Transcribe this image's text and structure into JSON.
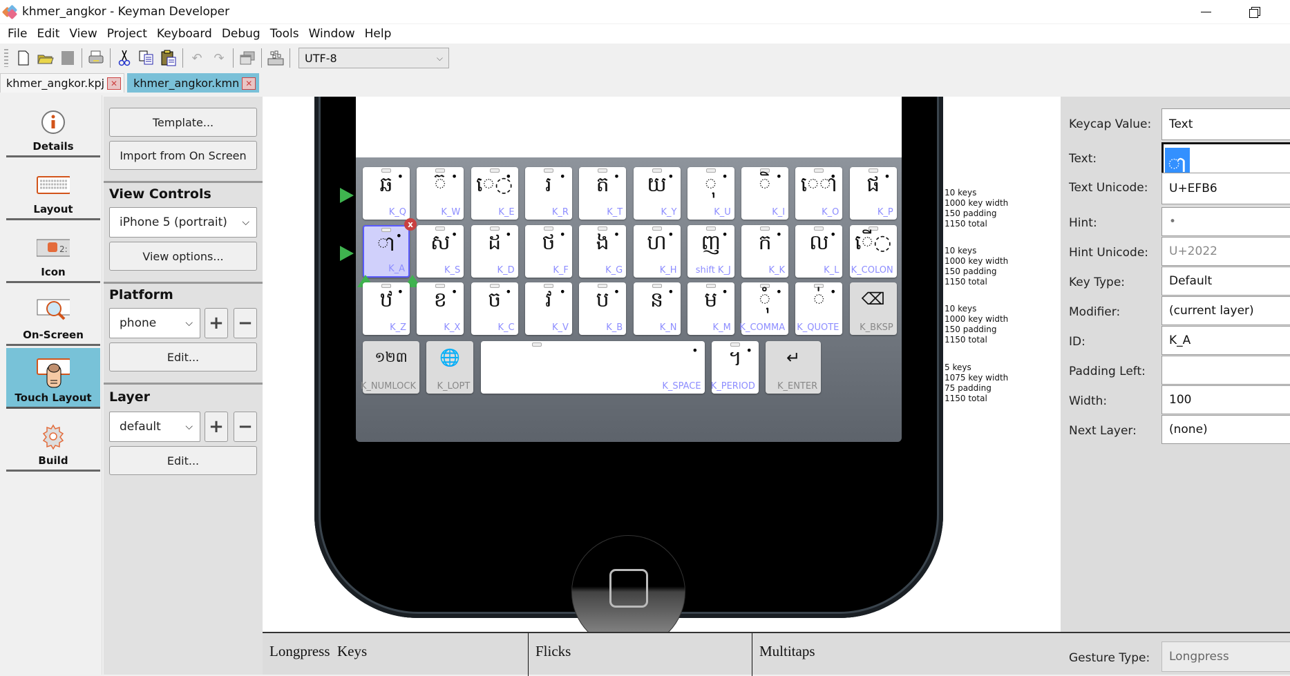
{
  "window": {
    "title": "khmer_angkor - Keyman Developer",
    "minimize_icon": "minimize-icon",
    "restore_icon": "restore-icon"
  },
  "menu": [
    "File",
    "Edit",
    "View",
    "Project",
    "Keyboard",
    "Debug",
    "Tools",
    "Window",
    "Help"
  ],
  "toolbar": {
    "icons": [
      "new-file-icon",
      "open-folder-icon",
      "save-icon",
      "print-icon",
      "cut-icon",
      "copy-icon",
      "paste-icon",
      "undo-icon",
      "redo-icon",
      "window-icon",
      "keyboard-charmap-icon"
    ],
    "encoding": "UTF-8"
  },
  "tabs": [
    {
      "label": "khmer_angkor.kpj",
      "active": false
    },
    {
      "label": "khmer_angkor.kmn",
      "active": true
    }
  ],
  "nav": [
    {
      "label": "Details",
      "icon": "info-icon",
      "active": false
    },
    {
      "label": "Layout",
      "icon": "keyboard-icon",
      "active": false
    },
    {
      "label": "Icon",
      "icon": "icon-preview-icon",
      "active": false
    },
    {
      "label": "On-Screen",
      "icon": "onscreen-keyboard-icon",
      "active": false
    },
    {
      "label": "Touch Layout",
      "icon": "touch-keyboard-icon",
      "active": true
    },
    {
      "label": "Build",
      "icon": "gear-icon",
      "active": false
    }
  ],
  "left_panel": {
    "template_btn": "Template...",
    "import_btn": "Import from On Screen",
    "view_controls_heading": "View Controls",
    "device": "iPhone 5 (portrait)",
    "view_options_btn": "View options...",
    "platform_heading": "Platform",
    "platform": "phone",
    "platform_edit_btn": "Edit...",
    "layer_heading": "Layer",
    "layer": "default",
    "layer_edit_btn": "Edit...",
    "add_symbol": "+",
    "remove_symbol": "−"
  },
  "keyboard": {
    "rows": [
      [
        {
          "cap": "ឆ",
          "id": "K_Q",
          "hint": "•"
        },
        {
          "cap": "◌៊",
          "id": "K_W",
          "hint": "•"
        },
        {
          "cap": "េ◌",
          "id": "K_E",
          "hint": "•"
        },
        {
          "cap": "រ",
          "id": "K_R",
          "hint": "•"
        },
        {
          "cap": "ត",
          "id": "K_T",
          "hint": "•"
        },
        {
          "cap": "យ",
          "id": "K_Y",
          "hint": "•"
        },
        {
          "cap": "◌ុ",
          "id": "K_U",
          "hint": "•"
        },
        {
          "cap": "◌ិ",
          "id": "K_I",
          "hint": "•"
        },
        {
          "cap": "េ◌ា",
          "id": "K_O",
          "hint": "•"
        },
        {
          "cap": "ផ",
          "id": "K_P",
          "hint": "•"
        }
      ],
      [
        {
          "cap": "◌ា",
          "id": "K_A",
          "hint": "•",
          "selected": true
        },
        {
          "cap": "ស",
          "id": "K_S",
          "hint": "•"
        },
        {
          "cap": "ដ",
          "id": "K_D",
          "hint": "•"
        },
        {
          "cap": "ថ",
          "id": "K_F",
          "hint": "•"
        },
        {
          "cap": "ង",
          "id": "K_G",
          "hint": "•"
        },
        {
          "cap": "ហ",
          "id": "K_H",
          "hint": "•"
        },
        {
          "cap": "ញ",
          "id": "shift K_J",
          "hint": "•"
        },
        {
          "cap": "ក",
          "id": "K_K",
          "hint": "•"
        },
        {
          "cap": "ល",
          "id": "K_L",
          "hint": "•"
        },
        {
          "cap": "ើ◌",
          "id": "K_COLON",
          "hint": ""
        }
      ],
      [
        {
          "cap": "ឋ",
          "id": "K_Z",
          "hint": "•"
        },
        {
          "cap": "ខ",
          "id": "K_X",
          "hint": "•"
        },
        {
          "cap": "ច",
          "id": "K_C",
          "hint": "•"
        },
        {
          "cap": "វ",
          "id": "K_V",
          "hint": "•"
        },
        {
          "cap": "ប",
          "id": "K_B",
          "hint": "•"
        },
        {
          "cap": "ន",
          "id": "K_N",
          "hint": "•"
        },
        {
          "cap": "ម",
          "id": "K_M",
          "hint": "•"
        },
        {
          "cap": "◌ុំ",
          "id": "K_COMMA",
          "hint": "•"
        },
        {
          "cap": "◌់",
          "id": "K_QUOTE",
          "hint": "•"
        },
        {
          "cap": "⌫",
          "id": "K_BKSP",
          "hint": "",
          "special": true
        }
      ],
      [
        {
          "cap": "១២៣",
          "id": "K_NUMLOCK",
          "hint": "",
          "special": true
        },
        {
          "cap": "🌐",
          "id": "K_LOPT",
          "hint": "",
          "special": true
        },
        {
          "cap": "",
          "id": "K_SPACE",
          "hint": "•"
        },
        {
          "cap": "។",
          "id": "K_PERIOD",
          "hint": "•"
        },
        {
          "cap": "↵",
          "id": "K_ENTER",
          "hint": "",
          "special": true
        }
      ]
    ],
    "row_info": [
      "10 keys\n1000 key width\n150 padding\n1150 total",
      "10 keys\n1000 key width\n150 padding\n1150 total",
      "10 keys\n1000 key width\n150 padding\n1150 total",
      "5 keys\n1075 key width\n75 padding\n1150 total"
    ],
    "delete_badge": "x"
  },
  "properties": {
    "keycap_value_label": "Keycap Value:",
    "keycap_value": "Text",
    "text_label": "Text:",
    "text_value": "◌ា",
    "text_unicode_label": "Text Unicode:",
    "text_unicode": "U+EFB6",
    "hint_label": "Hint:",
    "hint": "•",
    "hint_unicode_label": "Hint Unicode:",
    "hint_unicode": "U+2022",
    "key_type_label": "Key Type:",
    "key_type": "Default",
    "modifier_label": "Modifier:",
    "modifier": "(current layer)",
    "id_label": "ID:",
    "id": "K_A",
    "padding_left_label": "Padding Left:",
    "padding_left": "",
    "width_label": "Width:",
    "width": "100",
    "next_layer_label": "Next Layer:",
    "next_layer": "(none)"
  },
  "gestures": {
    "longpress": "Longpress  Keys",
    "flicks": "Flicks",
    "multitaps": "Multitaps",
    "gesture_type_label": "Gesture Type:",
    "gesture_type": "Longpress"
  }
}
